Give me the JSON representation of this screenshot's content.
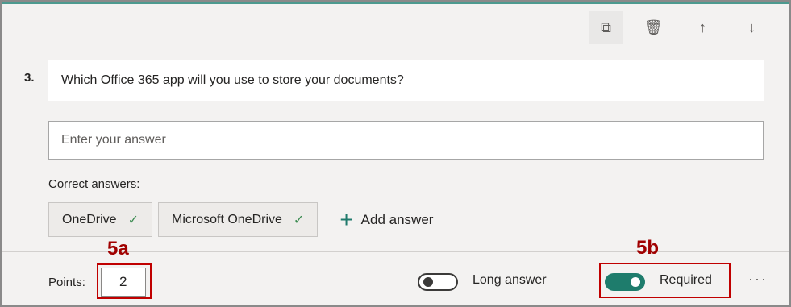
{
  "toolbar": {
    "icons": [
      "copy-icon",
      "delete-icon",
      "move-up-icon",
      "move-down-icon"
    ],
    "copy_glyph": "⧉",
    "delete_glyph": "🗑",
    "up_glyph": "↑",
    "down_glyph": "↓"
  },
  "question": {
    "number": "3.",
    "title": "Which Office 365 app will you use to store your documents?",
    "answer_placeholder": "Enter your answer"
  },
  "correct_answers": {
    "label": "Correct answers:",
    "items": [
      {
        "text": "OneDrive",
        "check": "✓"
      },
      {
        "text": "Microsoft OneDrive",
        "check": "✓"
      }
    ],
    "add_label": "Add answer",
    "add_glyph": "+"
  },
  "footer": {
    "points_label": "Points:",
    "points_value": "2",
    "long_answer_label": "Long answer",
    "long_answer_on": false,
    "required_label": "Required",
    "required_on": true,
    "more_glyph": "···"
  },
  "callouts": {
    "a": "5a",
    "b": "5b",
    "color": "#c00000"
  },
  "colors": {
    "accent": "#1e7c6c",
    "check": "#3a8a50"
  }
}
